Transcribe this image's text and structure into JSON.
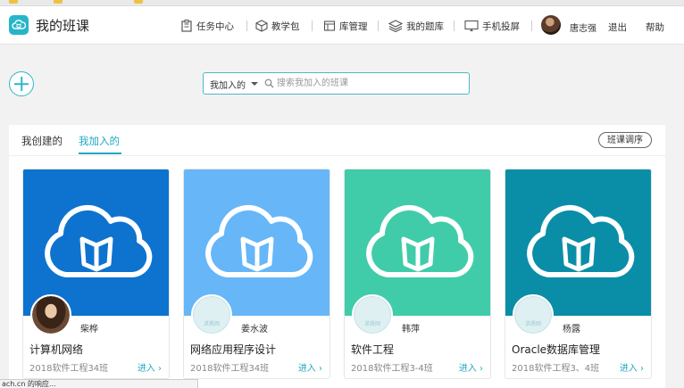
{
  "header": {
    "app_title": "我的班课",
    "nav": [
      {
        "label": "任务中心",
        "icon": "task-icon"
      },
      {
        "label": "教学包",
        "icon": "box-icon"
      },
      {
        "label": "库管理",
        "icon": "library-icon"
      },
      {
        "label": "我的题库",
        "icon": "layers-icon"
      },
      {
        "label": "手机投屏",
        "icon": "screen-cast-icon"
      }
    ],
    "username": "唐志强",
    "logout": "退出",
    "help": "帮助"
  },
  "search": {
    "filter": "我加入的",
    "placeholder": "搜索我加入的班课"
  },
  "tabs": {
    "created": "我创建的",
    "joined": "我加入的",
    "active": "joined"
  },
  "sort_button": "班课调序",
  "cards": [
    {
      "teacher": "柴桦",
      "course": "计算机网络",
      "class": "2018软件工程34班",
      "enter": "进入",
      "cover_color": "#0d73cf"
    },
    {
      "teacher": "姜水波",
      "course": "网络应用程序设计",
      "class": "2018软件工程34班",
      "enter": "进入",
      "cover_color": "#66b6f8"
    },
    {
      "teacher": "韩萍",
      "course": "软件工程",
      "class": "2018软件工程3-4班",
      "enter": "进入",
      "cover_color": "#40cca8"
    },
    {
      "teacher": "杨露",
      "course": "Oracle数据库管理",
      "class": "2018软件工程3、4班",
      "enter": "进入",
      "cover_color": "#0a8ea7"
    }
  ],
  "status_bar": "ach.cn 的响应..."
}
